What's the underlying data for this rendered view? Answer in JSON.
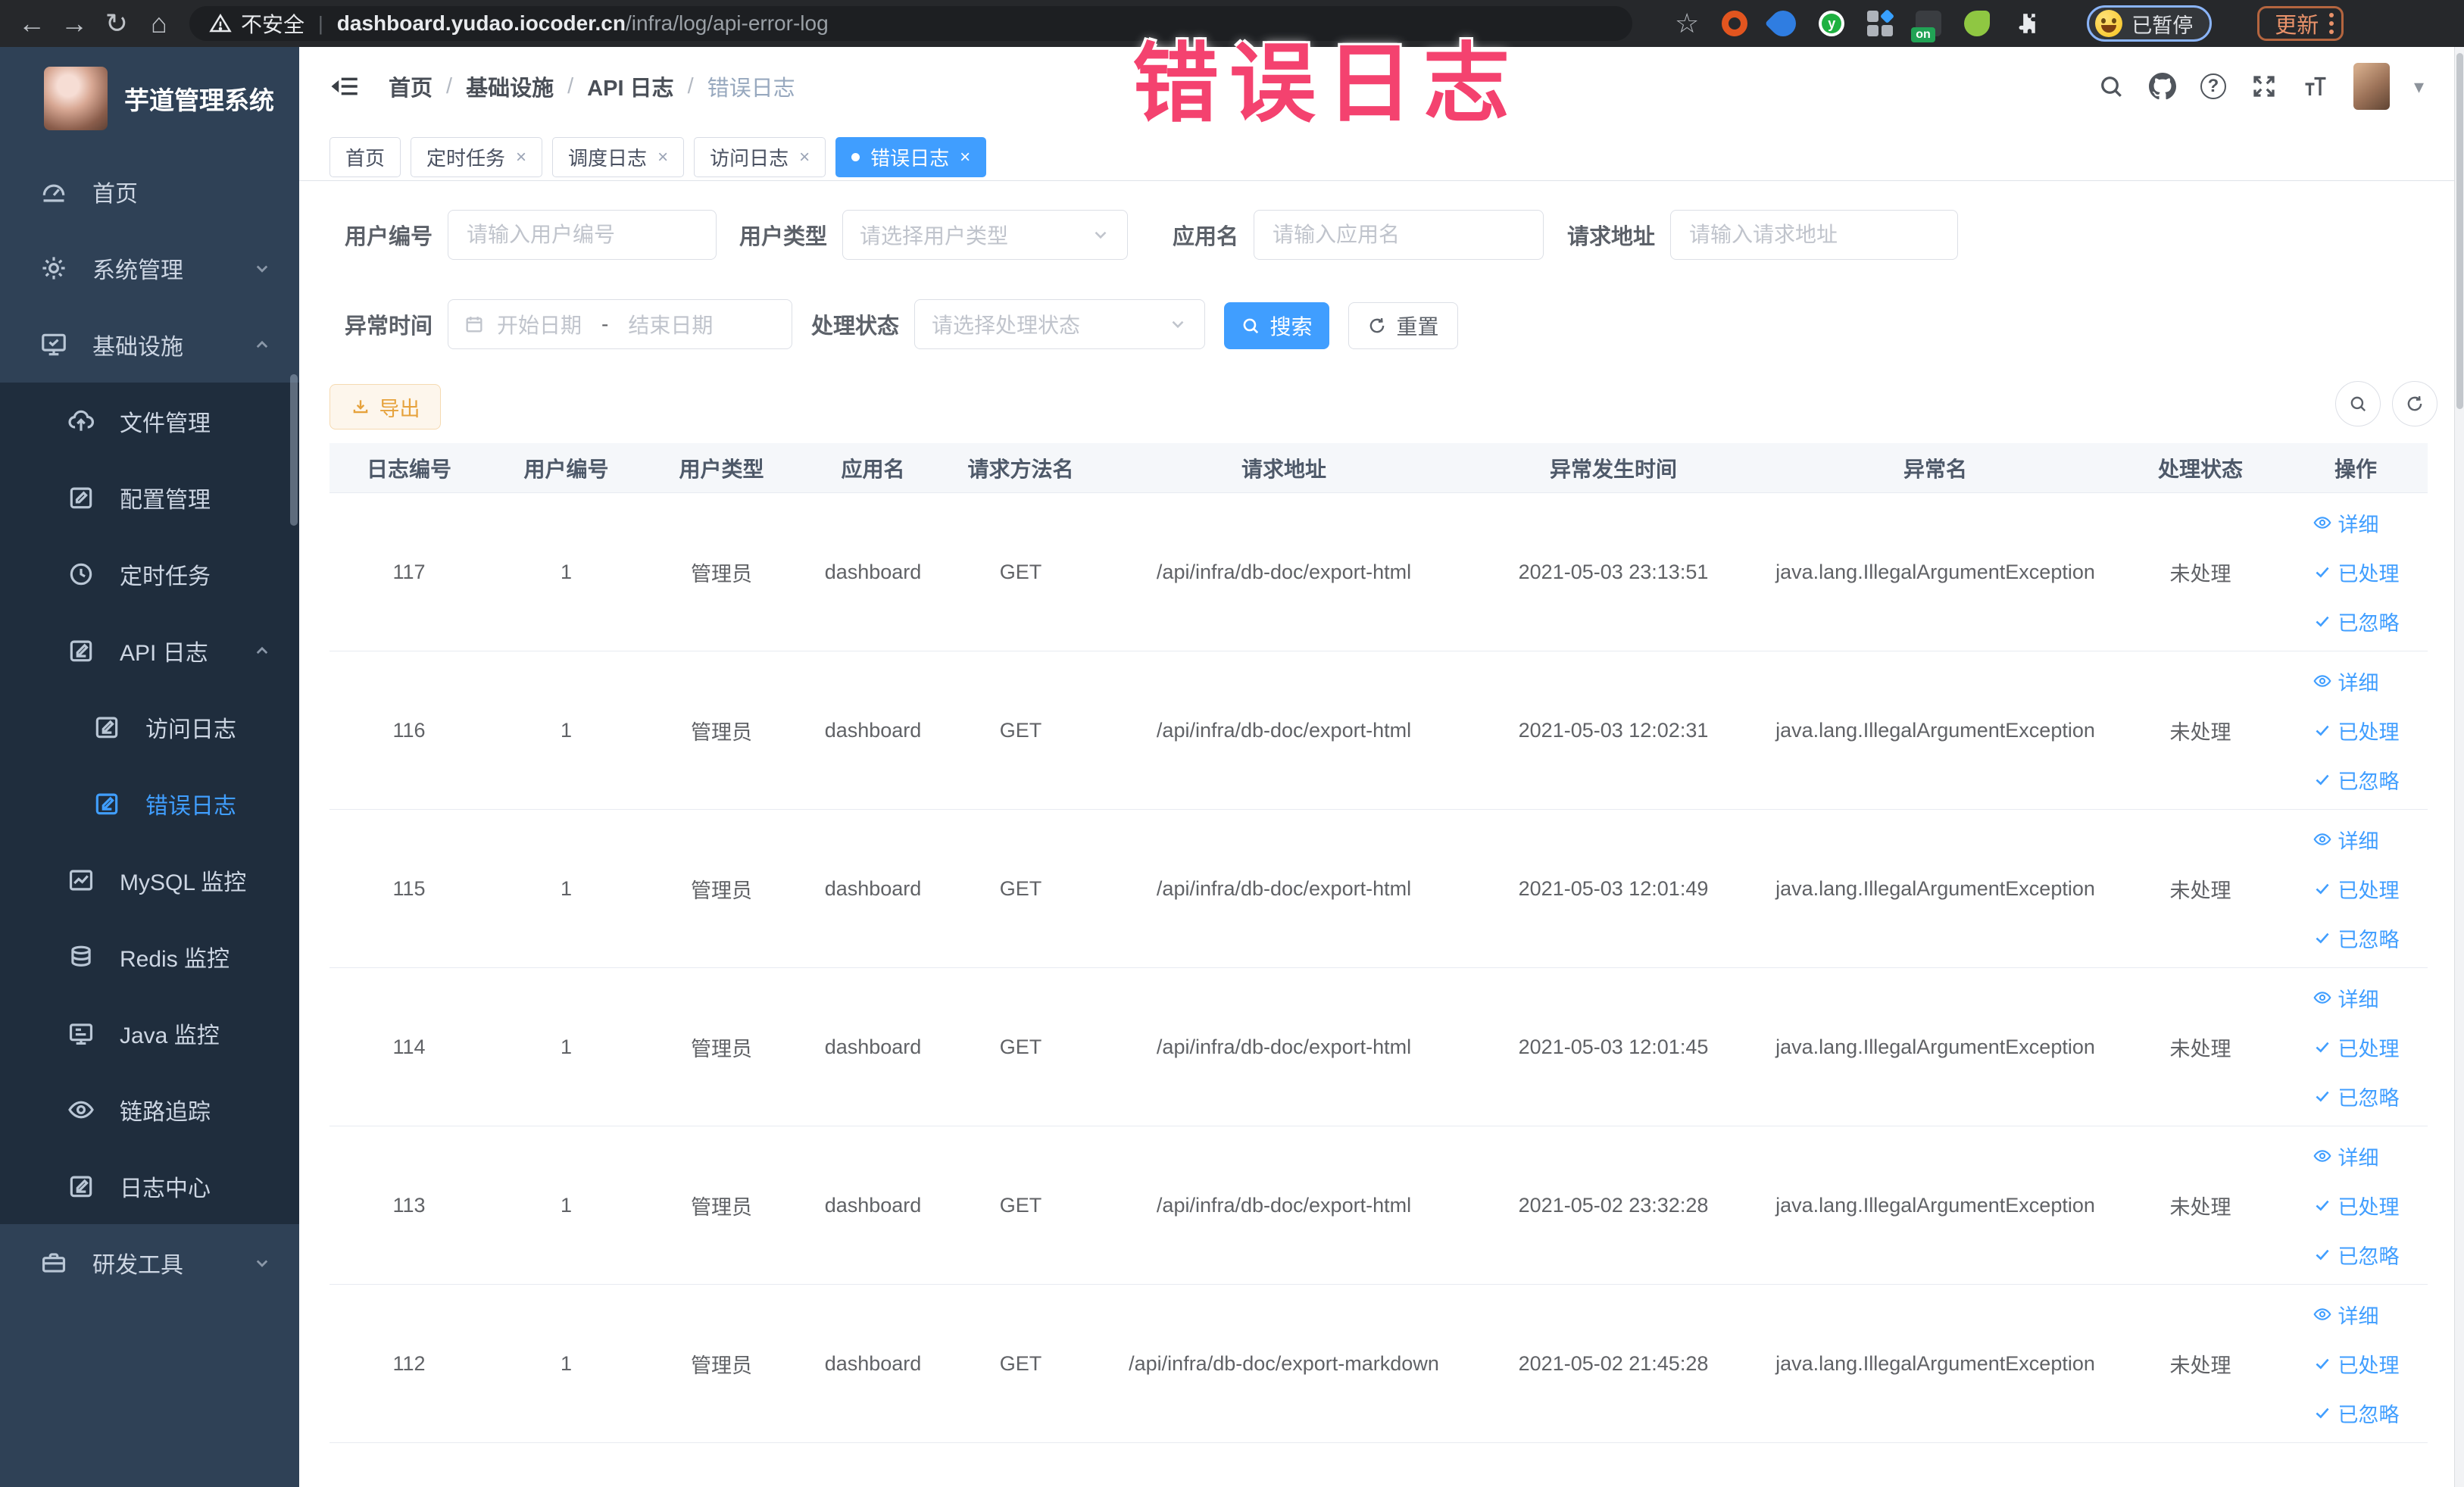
{
  "colors": {
    "accent": "#409eff",
    "annotation_pink": "#f4426f",
    "warning_orange": "#e6a23c",
    "sidebar_bg": "#2f4156",
    "submenu_bg": "#1f2d3d",
    "chrome_bar": "#26282b"
  },
  "annotation": {
    "text": "错误日志"
  },
  "browser": {
    "security_label": "不安全",
    "url_host": "dashboard.yudao.iocoder.cn",
    "url_path": "/infra/log/api-error-log",
    "extension_badge": "on",
    "extension_y_letter": "y",
    "profile_label": "已暂停",
    "update_label": "更新"
  },
  "sidebar": {
    "logo_title": "芋道管理系统",
    "items": [
      {
        "key": "home",
        "label": "首页",
        "icon": "dashboard-icon",
        "level": 1,
        "sub": false
      },
      {
        "key": "system",
        "label": "系统管理",
        "icon": "gear-icon",
        "level": 1,
        "sub": false,
        "chevron": "down"
      },
      {
        "key": "infra",
        "label": "基础设施",
        "icon": "monitor-icon",
        "level": 1,
        "sub": false,
        "chevron": "up"
      },
      {
        "key": "file",
        "label": "文件管理",
        "icon": "cloud-upload-icon",
        "level": 2,
        "sub": true
      },
      {
        "key": "config",
        "label": "配置管理",
        "icon": "edit-icon",
        "level": 2,
        "sub": true
      },
      {
        "key": "job",
        "label": "定时任务",
        "icon": "history-icon",
        "level": 2,
        "sub": true
      },
      {
        "key": "api-log",
        "label": "API 日志",
        "icon": "doc-edit-icon",
        "level": 2,
        "sub": true,
        "chevron": "up"
      },
      {
        "key": "access-log",
        "label": "访问日志",
        "icon": "doc-edit-icon",
        "level": 3,
        "sub": true
      },
      {
        "key": "error-log",
        "label": "错误日志",
        "icon": "doc-edit-icon",
        "level": 3,
        "sub": true,
        "active": true
      },
      {
        "key": "mysql",
        "label": "MySQL 监控",
        "icon": "chart-icon",
        "level": 2,
        "sub": true
      },
      {
        "key": "redis",
        "label": "Redis 监控",
        "icon": "stack-icon",
        "level": 2,
        "sub": true
      },
      {
        "key": "java",
        "label": "Java 监控",
        "icon": "java-monitor-icon",
        "level": 2,
        "sub": true
      },
      {
        "key": "trace",
        "label": "链路追踪",
        "icon": "eye-icon",
        "level": 2,
        "sub": true
      },
      {
        "key": "log-center",
        "label": "日志中心",
        "icon": "doc-edit-icon",
        "level": 2,
        "sub": true
      },
      {
        "key": "devtools",
        "label": "研发工具",
        "icon": "toolbox-icon",
        "level": 1,
        "sub": false,
        "chevron": "down"
      }
    ]
  },
  "breadcrumb": {
    "items": [
      "首页",
      "基础设施",
      "API 日志",
      "错误日志"
    ],
    "separator": "/"
  },
  "tabs": [
    {
      "label": "首页",
      "closable": false,
      "active": false
    },
    {
      "label": "定时任务",
      "closable": true,
      "active": false
    },
    {
      "label": "调度日志",
      "closable": true,
      "active": false
    },
    {
      "label": "访问日志",
      "closable": true,
      "active": false
    },
    {
      "label": "错误日志",
      "closable": true,
      "active": true
    }
  ],
  "filters": {
    "user_id_label": "用户编号",
    "user_id_placeholder": "请输入用户编号",
    "user_type_label": "用户类型",
    "user_type_placeholder": "请选择用户类型",
    "app_name_label": "应用名",
    "app_name_placeholder": "请输入应用名",
    "request_url_label": "请求地址",
    "request_url_placeholder": "请输入请求地址",
    "exception_time_label": "异常时间",
    "date_start_placeholder": "开始日期",
    "date_separator": "-",
    "date_end_placeholder": "结束日期",
    "process_status_label": "处理状态",
    "process_status_placeholder": "请选择处理状态",
    "search_button": "搜索",
    "reset_button": "重置"
  },
  "toolbar": {
    "export_button": "导出"
  },
  "table": {
    "headers": [
      "日志编号",
      "用户编号",
      "用户类型",
      "应用名",
      "请求方法名",
      "请求地址",
      "异常发生时间",
      "异常名",
      "处理状态",
      "操作"
    ],
    "actions": [
      {
        "label": "详细",
        "icon": "eye-icon"
      },
      {
        "label": "已处理",
        "icon": "check-icon"
      },
      {
        "label": "已忽略",
        "icon": "check-icon"
      }
    ],
    "rows": [
      {
        "log_id": "117",
        "user_id": "1",
        "user_type": "管理员",
        "app_name": "dashboard",
        "method": "GET",
        "request_url": "/api/infra/db-doc/export-html",
        "exception_time": "2021-05-03 23:13:51",
        "exception_name": "java.lang.IllegalArgumentException",
        "status": "未处理"
      },
      {
        "log_id": "116",
        "user_id": "1",
        "user_type": "管理员",
        "app_name": "dashboard",
        "method": "GET",
        "request_url": "/api/infra/db-doc/export-html",
        "exception_time": "2021-05-03 12:02:31",
        "exception_name": "java.lang.IllegalArgumentException",
        "status": "未处理"
      },
      {
        "log_id": "115",
        "user_id": "1",
        "user_type": "管理员",
        "app_name": "dashboard",
        "method": "GET",
        "request_url": "/api/infra/db-doc/export-html",
        "exception_time": "2021-05-03 12:01:49",
        "exception_name": "java.lang.IllegalArgumentException",
        "status": "未处理"
      },
      {
        "log_id": "114",
        "user_id": "1",
        "user_type": "管理员",
        "app_name": "dashboard",
        "method": "GET",
        "request_url": "/api/infra/db-doc/export-html",
        "exception_time": "2021-05-03 12:01:45",
        "exception_name": "java.lang.IllegalArgumentException",
        "status": "未处理"
      },
      {
        "log_id": "113",
        "user_id": "1",
        "user_type": "管理员",
        "app_name": "dashboard",
        "method": "GET",
        "request_url": "/api/infra/db-doc/export-html",
        "exception_time": "2021-05-02 23:32:28",
        "exception_name": "java.lang.IllegalArgumentException",
        "status": "未处理"
      },
      {
        "log_id": "112",
        "user_id": "1",
        "user_type": "管理员",
        "app_name": "dashboard",
        "method": "GET",
        "request_url": "/api/infra/db-doc/export-markdown",
        "exception_time": "2021-05-02 21:45:28",
        "exception_name": "java.lang.IllegalArgumentException",
        "status": "未处理"
      }
    ]
  }
}
